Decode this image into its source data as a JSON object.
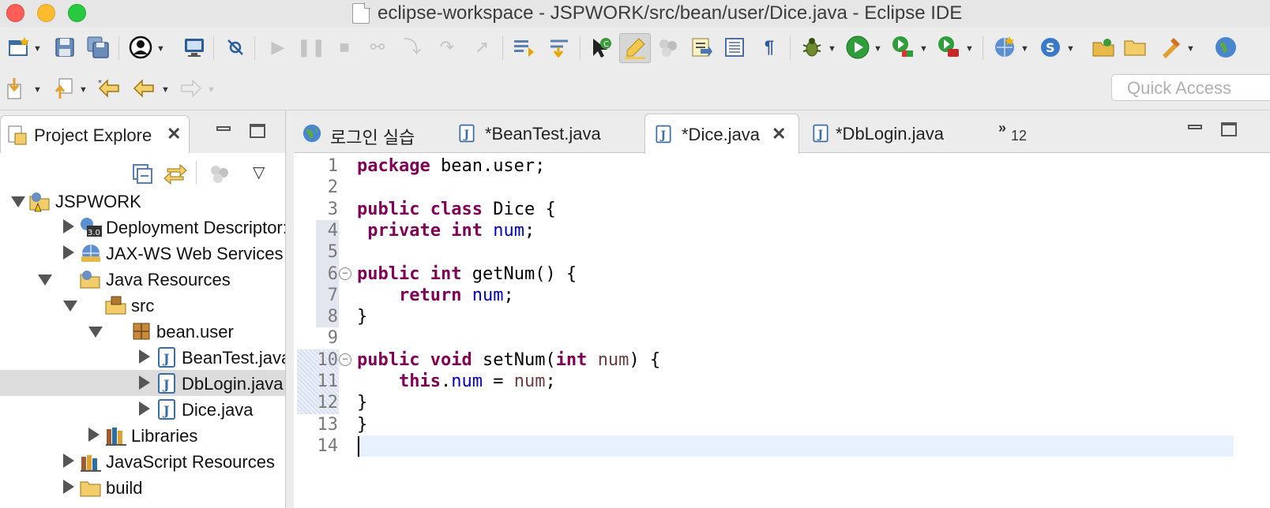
{
  "window": {
    "title": "eclipse-workspace - JSPWORK/src/bean/user/Dice.java - Eclipse IDE"
  },
  "toolbar": {
    "quick_access_placeholder": "Quick Access"
  },
  "explorer": {
    "tab_label": "Project Explore",
    "tree": [
      {
        "label": "JSPWORK",
        "depth": 0,
        "state": "expanded",
        "icon": "project-icon"
      },
      {
        "label": "Deployment Descriptor: .",
        "depth": 1,
        "state": "collapsed",
        "icon": "deployment-descriptor-icon"
      },
      {
        "label": "JAX-WS Web Services",
        "depth": 1,
        "state": "collapsed",
        "icon": "web-services-icon"
      },
      {
        "label": "Java Resources",
        "depth": 1,
        "state": "expanded",
        "icon": "java-resources-icon"
      },
      {
        "label": "src",
        "depth": 2,
        "state": "expanded",
        "icon": "source-folder-icon"
      },
      {
        "label": "bean.user",
        "depth": 3,
        "state": "expanded",
        "icon": "package-icon"
      },
      {
        "label": "BeanTest.java",
        "depth": 4,
        "state": "collapsed",
        "icon": "java-file-icon"
      },
      {
        "label": "DbLogin.java",
        "depth": 4,
        "state": "collapsed",
        "icon": "java-file-icon",
        "selected": true
      },
      {
        "label": "Dice.java",
        "depth": 4,
        "state": "collapsed",
        "icon": "java-file-icon"
      },
      {
        "label": "Libraries",
        "depth": 2,
        "state": "collapsed",
        "icon": "libraries-icon"
      },
      {
        "label": "JavaScript Resources",
        "depth": 1,
        "state": "collapsed",
        "icon": "javascript-resources-icon"
      },
      {
        "label": "build",
        "depth": 1,
        "state": "collapsed",
        "icon": "folder-icon"
      }
    ]
  },
  "editor": {
    "tabs": [
      {
        "label": "로그인 실습",
        "icon": "web-browser-icon",
        "active": false
      },
      {
        "label": "*BeanTest.java",
        "icon": "java-file-icon",
        "active": false
      },
      {
        "label": "*Dice.java",
        "icon": "java-file-icon",
        "active": true
      },
      {
        "label": "*DbLogin.java",
        "icon": "java-file-icon",
        "active": false
      }
    ],
    "overflow_count": "12",
    "line_numbers": [
      "1",
      "2",
      "3",
      "4",
      "5",
      "6",
      "7",
      "8",
      "9",
      "10",
      "11",
      "12",
      "13",
      "14"
    ],
    "cursor_line": 14,
    "code_lines": [
      [
        {
          "t": "package",
          "c": "kw"
        },
        {
          "t": " bean.user;"
        }
      ],
      [],
      [
        {
          "t": "public",
          "c": "kw"
        },
        {
          "t": " "
        },
        {
          "t": "class",
          "c": "kw"
        },
        {
          "t": " Dice {"
        }
      ],
      [
        {
          "t": " "
        },
        {
          "t": "private",
          "c": "kw"
        },
        {
          "t": " "
        },
        {
          "t": "int",
          "c": "kw"
        },
        {
          "t": " "
        },
        {
          "t": "num",
          "c": "fld"
        },
        {
          "t": ";"
        }
      ],
      [],
      [
        {
          "t": "public",
          "c": "kw"
        },
        {
          "t": " "
        },
        {
          "t": "int",
          "c": "kw"
        },
        {
          "t": " getNum() {"
        }
      ],
      [
        {
          "t": "    "
        },
        {
          "t": "return",
          "c": "kw"
        },
        {
          "t": " "
        },
        {
          "t": "num",
          "c": "fld"
        },
        {
          "t": ";"
        }
      ],
      [
        {
          "t": "}"
        }
      ],
      [],
      [
        {
          "t": "public",
          "c": "kw"
        },
        {
          "t": " "
        },
        {
          "t": "void",
          "c": "kw"
        },
        {
          "t": " setNum("
        },
        {
          "t": "int",
          "c": "kw"
        },
        {
          "t": " "
        },
        {
          "t": "num",
          "c": "par"
        },
        {
          "t": ") {"
        }
      ],
      [
        {
          "t": "    "
        },
        {
          "t": "this",
          "c": "kw"
        },
        {
          "t": "."
        },
        {
          "t": "num",
          "c": "fld"
        },
        {
          "t": " = "
        },
        {
          "t": "num",
          "c": "par"
        },
        {
          "t": ";"
        }
      ],
      [
        {
          "t": "}"
        }
      ],
      [
        {
          "t": "}"
        }
      ],
      []
    ]
  },
  "colors": {
    "keyword": "#7f0055",
    "field": "#0000c0",
    "parameter": "#6a3e3e",
    "current_line": "#e8f2fe",
    "selection_row": "#dcdcdc"
  }
}
